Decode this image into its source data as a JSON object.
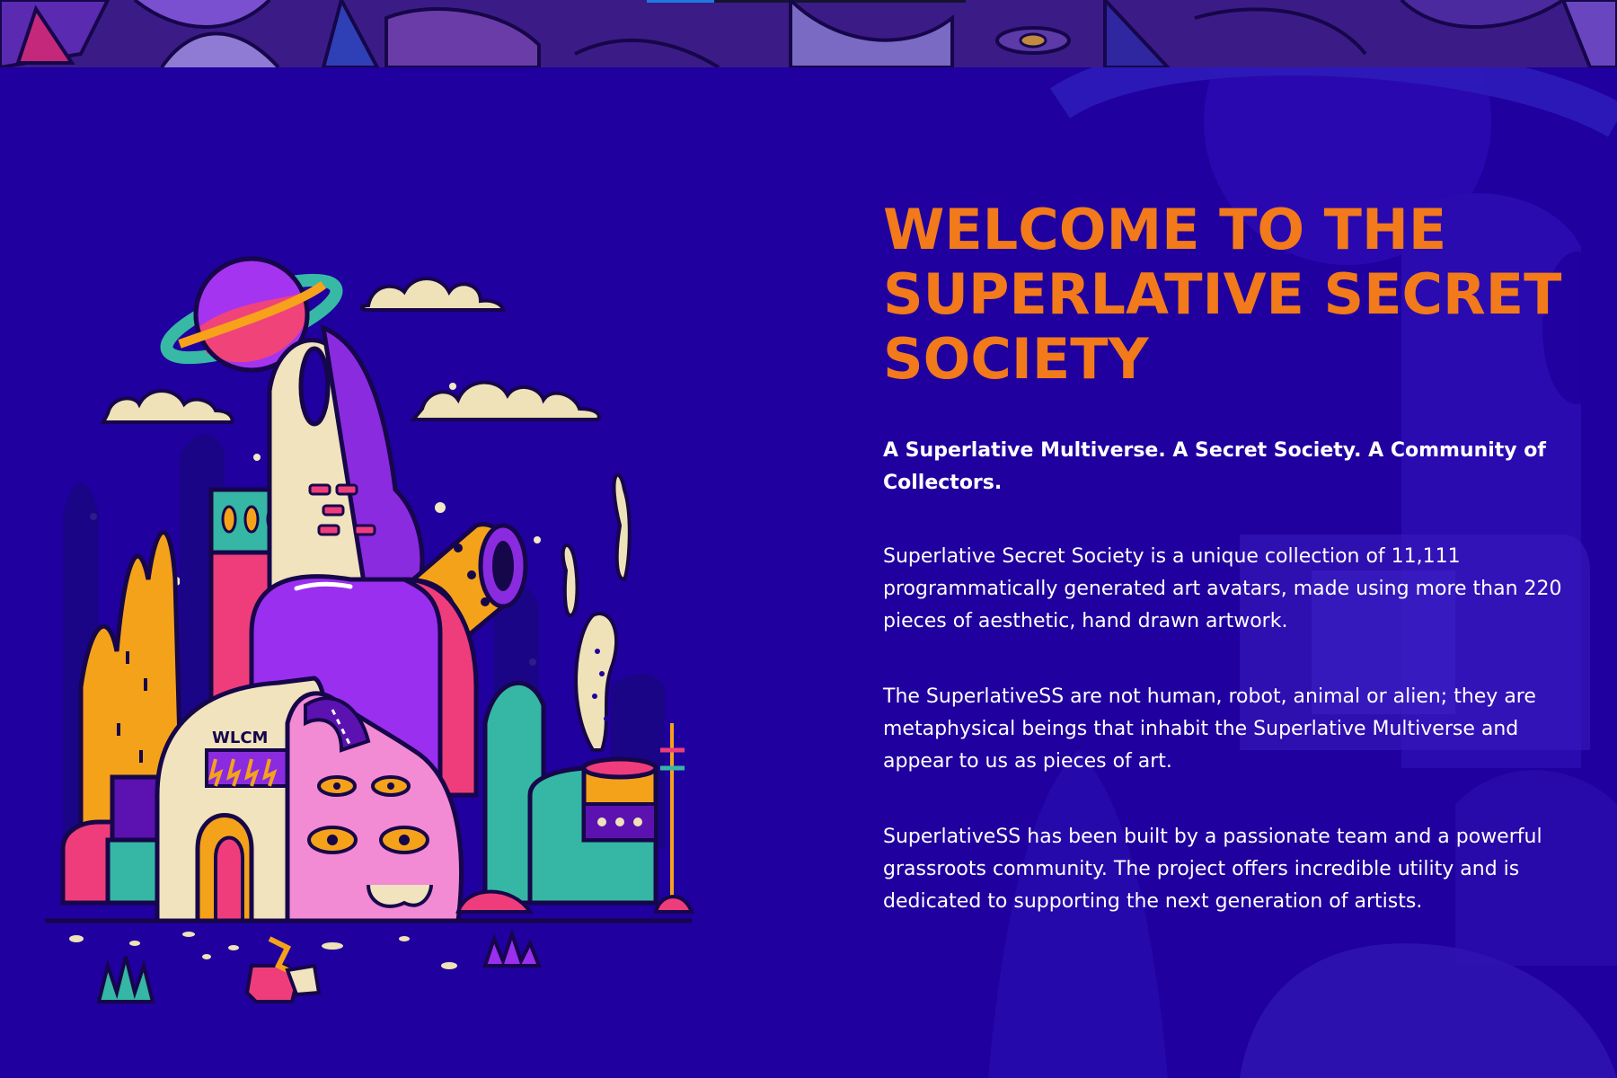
{
  "header_banner": {
    "image_name": "cosmic-doodle-banner-art"
  },
  "hero_image": {
    "image_name": "wlcm-city-illustration",
    "sign_text": "WLCM"
  },
  "about": {
    "heading": "WELCOME TO THE SUPERLATIVE SECRET SOCIETY",
    "tagline": "A Superlative Multiverse. A Secret Society. A Community of Collectors.",
    "paragraphs": [
      "Superlative Secret Society is a unique collection of 11,111 programmatically generated art avatars, made using more than 220 pieces of aesthetic, hand drawn artwork.",
      "The SuperlativeSS are not human, robot, animal or alien; they are metaphysical beings that inhabit the Superlative Multiverse and appear to us as pieces of art.",
      "SuperlativeSS has been built by a passionate team and a powerful grassroots community. The project offers incredible utility and is dedicated to supporting the next generation of artists."
    ]
  },
  "colors": {
    "background": "#20009e",
    "heading": "#f27a1a",
    "text": "#ffffff"
  }
}
